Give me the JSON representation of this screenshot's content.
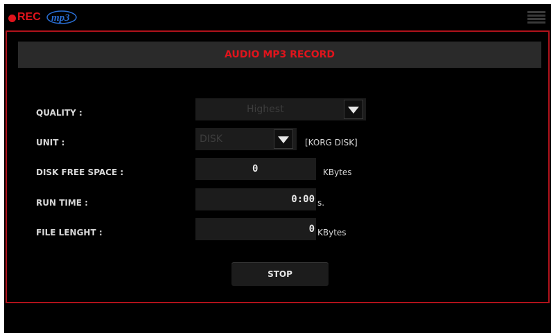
{
  "header": {
    "rec_label": "REC",
    "logo_text": "mp3",
    "menu_icon": "hamburger-menu-icon"
  },
  "panel": {
    "title": "AUDIO MP3 RECORD",
    "quality": {
      "label": "QUALITY :",
      "value": "Highest"
    },
    "unit": {
      "label": "UNIT :",
      "value": "DISK",
      "note": "[KORG DISK]"
    },
    "disk_free_space": {
      "label": "DISK FREE SPACE :",
      "value": "0",
      "unit": "KBytes"
    },
    "run_time": {
      "label": "RUN TIME :",
      "value": "0:00",
      "unit": "s."
    },
    "file_length": {
      "label": "FILE LENGHT :",
      "value": "0",
      "unit": "KBytes"
    },
    "stop_label": "STOP"
  },
  "colors": {
    "accent": "#e0141c",
    "panel_border": "#b0121b",
    "background": "#000000",
    "field": "#1c1c1c"
  }
}
